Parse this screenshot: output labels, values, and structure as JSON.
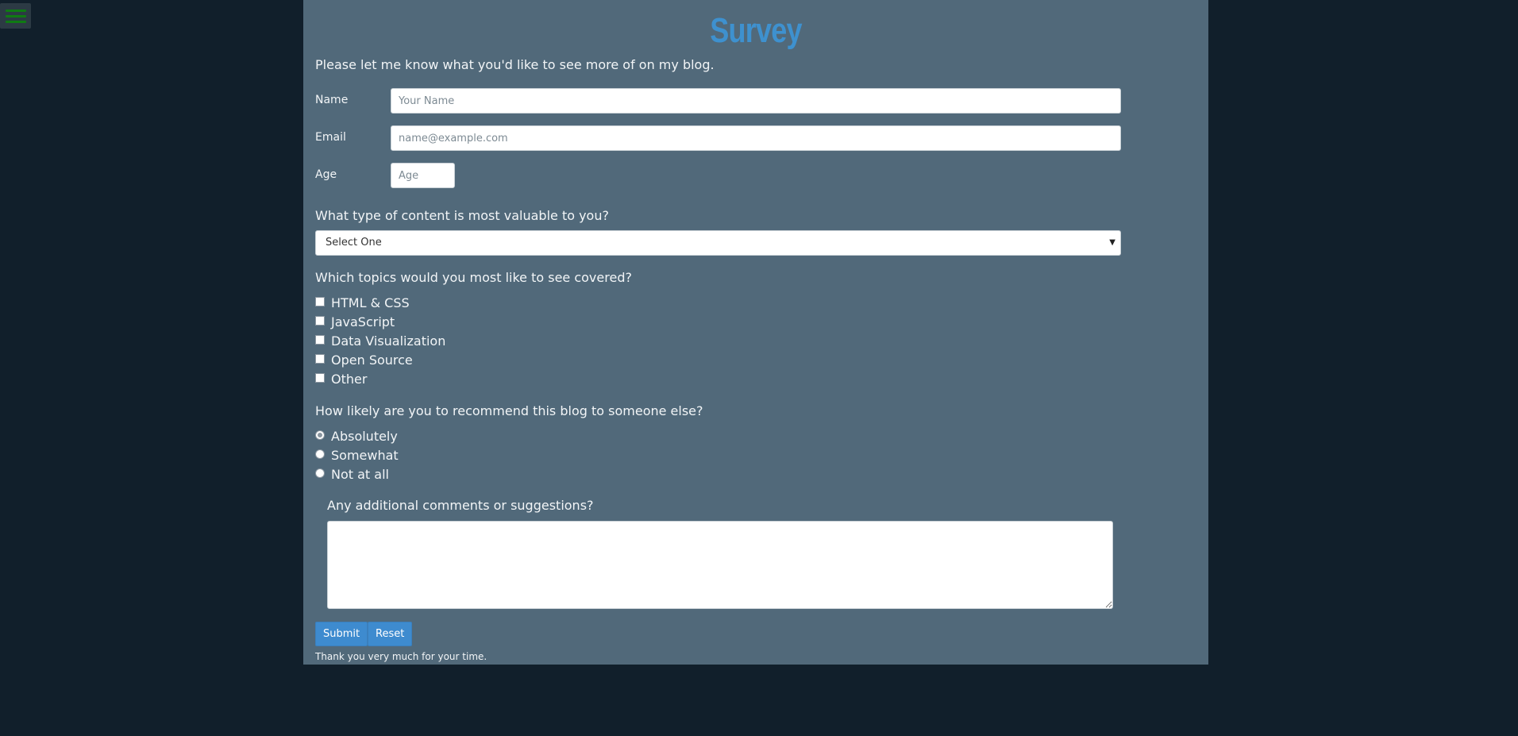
{
  "menu": {
    "icon": "hamburger-icon"
  },
  "title": "Survey",
  "intro": "Please let me know what you'd like to see more of on my blog.",
  "fields": {
    "name": {
      "label": "Name",
      "placeholder": "Your Name"
    },
    "email": {
      "label": "Email",
      "placeholder": "name@example.com"
    },
    "age": {
      "label": "Age",
      "placeholder": "Age"
    }
  },
  "content_question": {
    "label": "What type of content is most valuable to you?",
    "selected": "Select One"
  },
  "topics_question": {
    "label": "Which topics would you most like to see covered?",
    "options": [
      "HTML & CSS",
      "JavaScript",
      "Data Visualization",
      "Open Source",
      "Other"
    ]
  },
  "recommend_question": {
    "label": "How likely are you to recommend this blog to someone else?",
    "options": [
      "Absolutely",
      "Somewhat",
      "Not at all"
    ],
    "selected": "Absolutely"
  },
  "comments": {
    "label": "Any additional comments or suggestions?"
  },
  "buttons": {
    "submit": "Submit",
    "reset": "Reset"
  },
  "thanks": "Thank you very much for your time.",
  "colors": {
    "page_bg": "#111f2b",
    "panel_bg": "#51697a",
    "accent": "#3e8bcf",
    "menu_icon": "#0f7a13"
  }
}
